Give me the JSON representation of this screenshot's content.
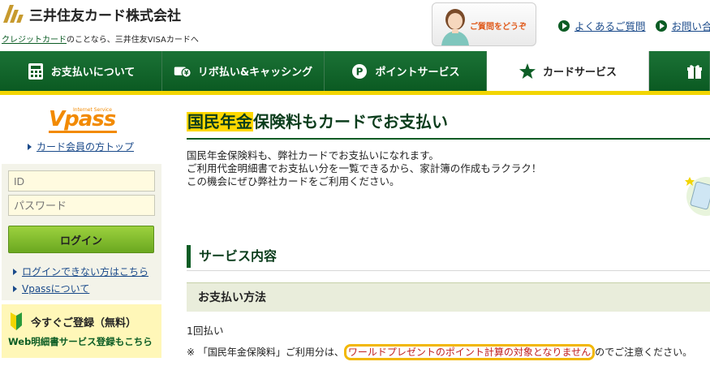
{
  "header": {
    "company": "三井住友カード株式会社",
    "tagline_link": "クレジットカード",
    "tagline_rest": "のことなら、三井住友VISAカードへ",
    "help_text": "ご質問をどうぞ",
    "links": [
      "よくあるご質問",
      "お問い合わせ"
    ]
  },
  "nav": {
    "items": [
      {
        "label": "お支払いについて",
        "icon": "calculator-icon"
      },
      {
        "label": "リボ払い&キャッシング",
        "icon": "card-yen-icon"
      },
      {
        "label": "ポイントサービス",
        "icon": "point-icon"
      },
      {
        "label": "カードサービス",
        "icon": "star-icon"
      },
      {
        "label": "",
        "icon": "gift-icon"
      }
    ]
  },
  "sidebar": {
    "logo": "Vpass",
    "logo_sub": "Internet Service",
    "member_top": "カード会員の方トップ",
    "id_placeholder": "ID",
    "password_placeholder": "パスワード",
    "login": "ログイン",
    "links": [
      "ログインできない方はこちら",
      "Vpassについて"
    ],
    "register_title": "今すぐご登録（無料）",
    "register_sub": "Web明細書サービス登録もこちら"
  },
  "main": {
    "title_highlight": "国民年金",
    "title_rest": "保険料もカードでお支払い",
    "intro": [
      "国民年金保険料も、弊社カードでお支払いになれます。",
      "ご利用代金明細書でお支払い分を一覧できるから、家計簿の作成もラクラク！",
      "この機会にぜひ弊社カードをご利用ください。"
    ],
    "section_title": "サービス内容",
    "sub_title": "お支払い方法",
    "payment": "1回払い",
    "note_prefix": "※ 「国民年金保険料」ご利用分は、",
    "note_highlight": "ワールドプレゼントのポイント計算の対象となりません",
    "note_suffix": "のでご注意ください。"
  },
  "colors": {
    "brand_green": "#0d5e26",
    "accent_yellow": "#f2d500",
    "highlight": "#ffd800"
  }
}
